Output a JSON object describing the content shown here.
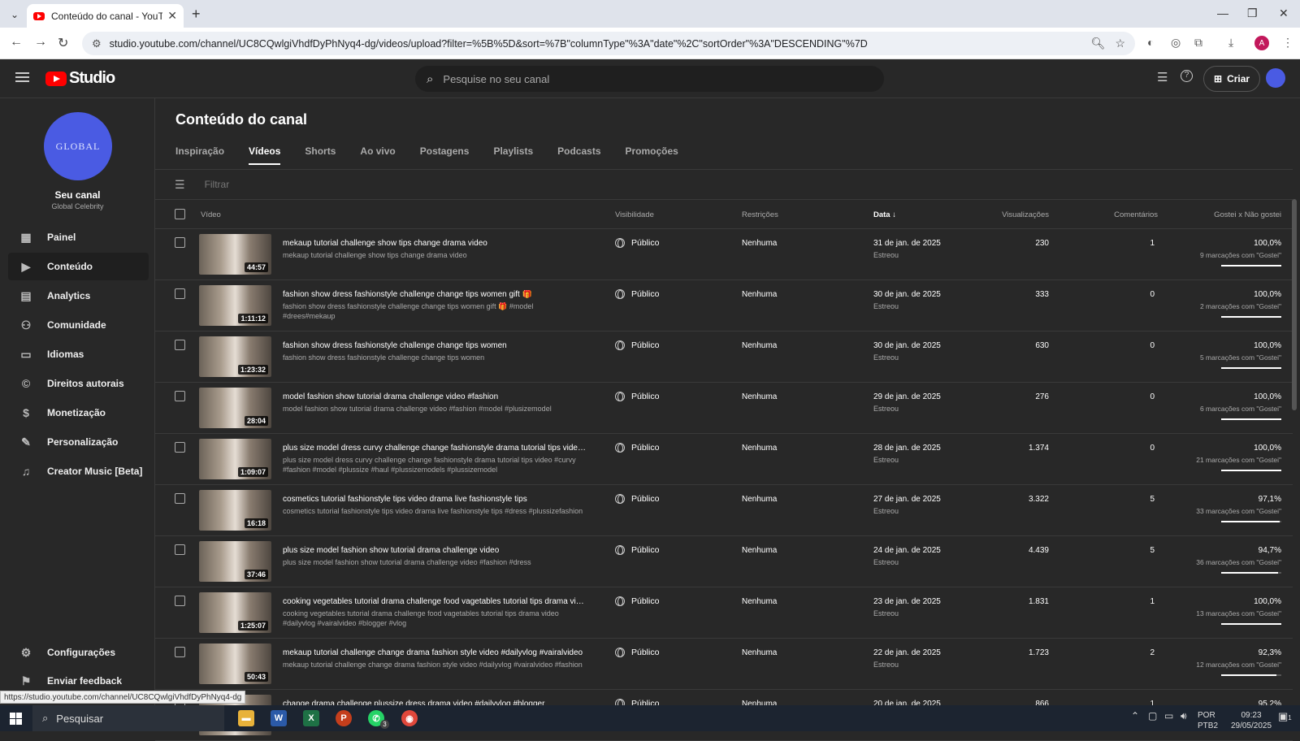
{
  "browser": {
    "tab_title": "Conteúdo do canal - YouTube S",
    "url": "studio.youtube.com/channel/UC8CQwlgiVhdfDyPhNyq4-dg/videos/upload?filter=%5B%5D&sort=%7B\"columnType\"%3A\"date\"%2C\"sortOrder\"%3A\"DESCENDING\"%7D",
    "profile_initial": "A",
    "status_url": "https://studio.youtube.com/channel/UC8CQwlgiVhdfDyPhNyq4-dg"
  },
  "header": {
    "logo_text": "Studio",
    "search_placeholder": "Pesquise no seu canal",
    "create_label": "Criar"
  },
  "sidebar": {
    "avatar_text": "GLOBAL",
    "channel_label": "Seu canal",
    "channel_name": "Global Celebrity",
    "items": [
      {
        "label": "Painel",
        "icon": "dashboard-icon"
      },
      {
        "label": "Conteúdo",
        "icon": "content-icon"
      },
      {
        "label": "Analytics",
        "icon": "analytics-icon"
      },
      {
        "label": "Comunidade",
        "icon": "community-icon"
      },
      {
        "label": "Idiomas",
        "icon": "subtitles-icon"
      },
      {
        "label": "Direitos autorais",
        "icon": "copyright-icon"
      },
      {
        "label": "Monetização",
        "icon": "dollar-icon"
      },
      {
        "label": "Personalização",
        "icon": "wand-icon"
      },
      {
        "label": "Creator Music [Beta]",
        "icon": "music-icon"
      }
    ],
    "settings_label": "Configurações",
    "feedback_label": "Enviar feedback"
  },
  "main": {
    "title": "Conteúdo do canal",
    "tabs": [
      "Inspiração",
      "Vídeos",
      "Shorts",
      "Ao vivo",
      "Postagens",
      "Playlists",
      "Podcasts",
      "Promoções"
    ],
    "active_tab": "Vídeos",
    "filter_placeholder": "Filtrar",
    "columns": {
      "video": "Vídeo",
      "visibility": "Visibilidade",
      "restrictions": "Restrições",
      "date": "Data",
      "views": "Visualizações",
      "comments": "Comentários",
      "likes": "Gostei x Não gostei"
    },
    "rows": [
      {
        "title": "mekaup tutorial challenge show tips change drama video",
        "desc": "mekaup tutorial challenge show tips change drama video",
        "duration": "44:57",
        "visibility": "Público",
        "restriction": "Nenhuma",
        "date": "31 de jan. de 2025",
        "date_status": "Estreou",
        "views": "230",
        "comments": "1",
        "like_pct": "100,0%",
        "like_count": "9 marcações com \"Gostei\"",
        "ratio": 1.0
      },
      {
        "title": "fashion show dress fashionstyle challenge change tips women gift 🎁",
        "desc": "fashion show dress fashionstyle challenge change tips women gift 🎁 #model #drees#mekaup",
        "duration": "1:11:12",
        "visibility": "Público",
        "restriction": "Nenhuma",
        "date": "30 de jan. de 2025",
        "date_status": "Estreou",
        "views": "333",
        "comments": "0",
        "like_pct": "100,0%",
        "like_count": "2 marcações com \"Gostei\"",
        "ratio": 1.0
      },
      {
        "title": "fashion show dress fashionstyle challenge change tips women",
        "desc": "fashion show dress fashionstyle challenge change tips women",
        "duration": "1:23:32",
        "visibility": "Público",
        "restriction": "Nenhuma",
        "date": "30 de jan. de 2025",
        "date_status": "Estreou",
        "views": "630",
        "comments": "0",
        "like_pct": "100,0%",
        "like_count": "5 marcações com \"Gostei\"",
        "ratio": 1.0
      },
      {
        "title": "model fashion show tutorial drama challenge video #fashion",
        "desc": "model fashion show tutorial drama challenge video #fashion #model #plusizemodel",
        "duration": "28:04",
        "visibility": "Público",
        "restriction": "Nenhuma",
        "date": "29 de jan. de 2025",
        "date_status": "Estreou",
        "views": "276",
        "comments": "0",
        "like_pct": "100,0%",
        "like_count": "6 marcações com \"Gostei\"",
        "ratio": 1.0
      },
      {
        "title": "plus size model dress curvy challenge change fashionstyle drama tutorial tips video #curvy",
        "desc": "plus size model dress curvy challenge change fashionstyle drama tutorial tips video #curvy #fashion #model #plussize #haul #plussizemodels #plussizemodel",
        "duration": "1:09:07",
        "visibility": "Público",
        "restriction": "Nenhuma",
        "date": "28 de jan. de 2025",
        "date_status": "Estreou",
        "views": "1.374",
        "comments": "0",
        "like_pct": "100,0%",
        "like_count": "21 marcações com \"Gostei\"",
        "ratio": 1.0
      },
      {
        "title": "cosmetics tutorial fashionstyle tips video drama live fashionstyle tips",
        "desc": "cosmetics tutorial fashionstyle tips video drama live fashionstyle tips #dress #plussizefashion",
        "duration": "16:18",
        "visibility": "Público",
        "restriction": "Nenhuma",
        "date": "27 de jan. de 2025",
        "date_status": "Estreou",
        "views": "3.322",
        "comments": "5",
        "like_pct": "97,1%",
        "like_count": "33 marcações com \"Gostei\"",
        "ratio": 0.971
      },
      {
        "title": "plus size model fashion show tutorial drama challenge video",
        "desc": "plus size model fashion show tutorial drama challenge video #fashion #dress",
        "duration": "37:46",
        "visibility": "Público",
        "restriction": "Nenhuma",
        "date": "24 de jan. de 2025",
        "date_status": "Estreou",
        "views": "4.439",
        "comments": "5",
        "like_pct": "94,7%",
        "like_count": "36 marcações com \"Gostei\"",
        "ratio": 0.947
      },
      {
        "title": "cooking vegetables tutorial drama challenge food vagetables tutorial tips drama video",
        "desc": "cooking vegetables tutorial drama challenge food vagetables tutorial tips drama video #dailyvlog #vairalvideo #blogger #vlog",
        "duration": "1:25:07",
        "visibility": "Público",
        "restriction": "Nenhuma",
        "date": "23 de jan. de 2025",
        "date_status": "Estreou",
        "views": "1.831",
        "comments": "1",
        "like_pct": "100,0%",
        "like_count": "13 marcações com \"Gostei\"",
        "ratio": 1.0
      },
      {
        "title": "mekaup tutorial challenge change drama fashion style video #dailyvlog #vairalvideo",
        "desc": "mekaup tutorial challenge change drama fashion style video #dailyvlog #vairalvideo #fashion",
        "duration": "50:43",
        "visibility": "Público",
        "restriction": "Nenhuma",
        "date": "22 de jan. de 2025",
        "date_status": "Estreou",
        "views": "1.723",
        "comments": "2",
        "like_pct": "92,3%",
        "like_count": "12 marcações com \"Gostei\"",
        "ratio": 0.923
      },
      {
        "title": "change drama challenge plussize dress drama video #dailyvlog #blogger",
        "desc": "",
        "duration": "",
        "visibility": "Público",
        "restriction": "Nenhuma",
        "date": "20 de jan. de 2025",
        "date_status": "",
        "views": "866",
        "comments": "1",
        "like_pct": "95,2%",
        "like_count": "",
        "ratio": 0.952
      }
    ]
  },
  "taskbar": {
    "search_label": "Pesquisar",
    "lang": "POR",
    "layout": "PTB2",
    "time": "09:23",
    "date": "29/05/2025",
    "whatsapp_badge": "3",
    "notif_count": "1"
  }
}
